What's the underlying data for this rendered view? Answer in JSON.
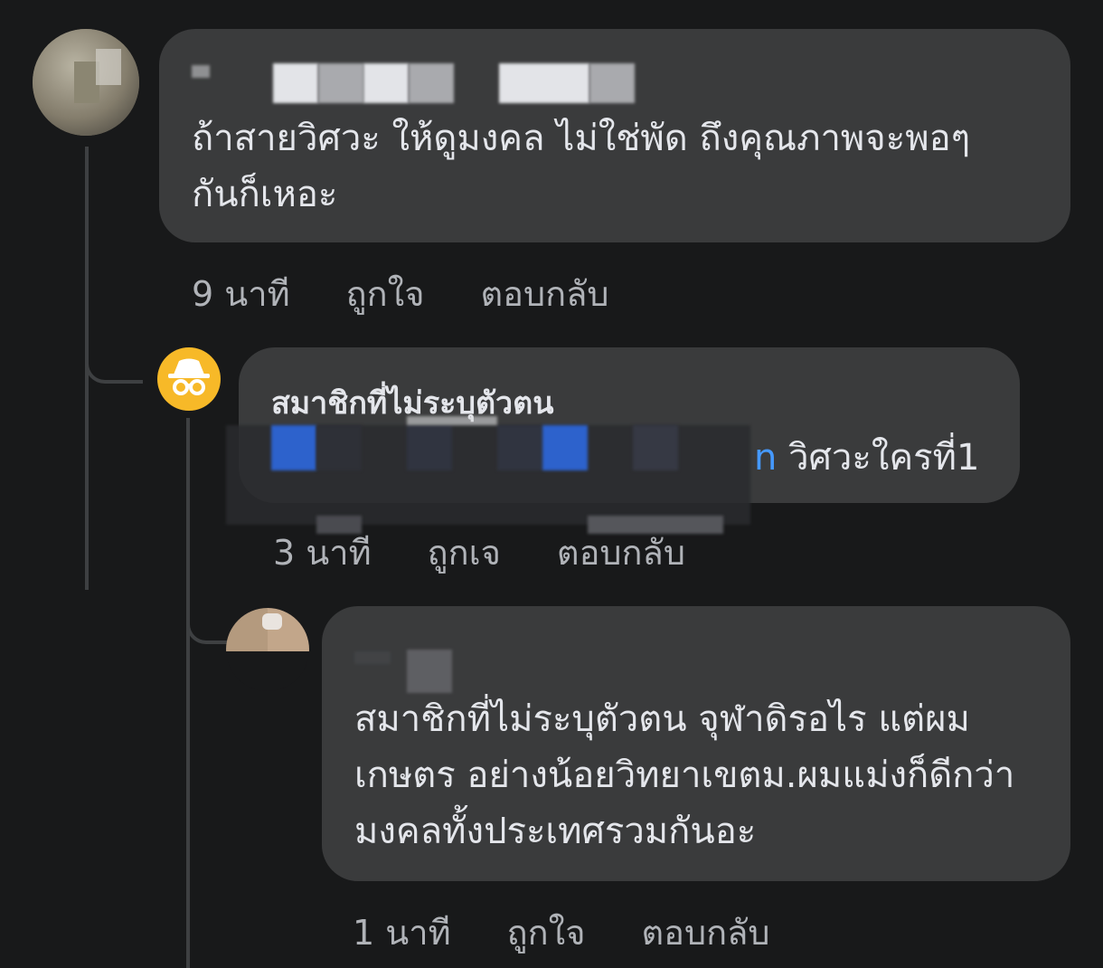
{
  "comments": [
    {
      "text": "ถ้าสายวิศวะ ให้ดูมงคล ไม่ใช่พัด ถึงคุณภาพจะพอๆกันก็เหอะ",
      "time": "9 นาที",
      "like_label": "ถูกใจ",
      "reply_label": "ตอบกลับ"
    },
    {
      "author": "สมาชิกที่ไม่ระบุตัวตน",
      "text_tail": "n วิศวะใครที่1",
      "time": "3 นาที",
      "like_label": "ถูกเจ",
      "reply_label": "ตอบกลับ"
    },
    {
      "text": "สมาชิกที่ไม่ระบุตัวตน จุฬาดิรอไร แต่ผมเกษตร อย่างน้อยวิทยาเขตม.ผมแม่งก็ดีกว่ามงคลทั้งประเทศรวมกันอะ",
      "time": "1 นาที",
      "like_label": "ถูกใจ",
      "reply_label": "ตอบกลับ"
    }
  ],
  "icons": {
    "anonymous_avatar": "incognito-icon"
  },
  "colors": {
    "anon_avatar_bg": "#f7b928",
    "mention_blue": "#4599ff"
  }
}
